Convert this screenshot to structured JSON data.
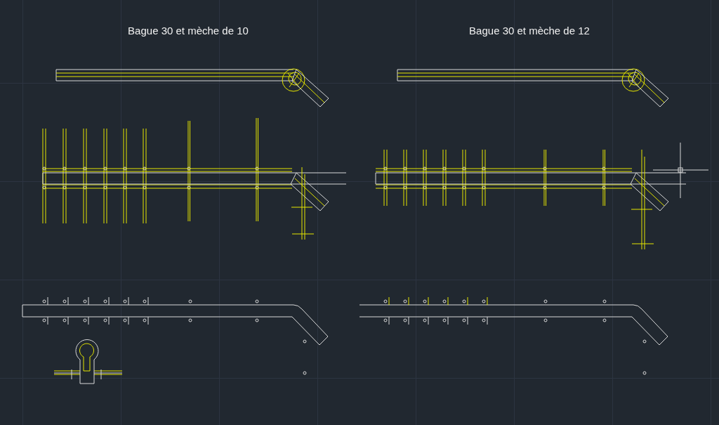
{
  "drawings": [
    {
      "title": "Bague 30 et mèche de 10"
    },
    {
      "title": "Bague 30 et mèche de 12"
    }
  ]
}
